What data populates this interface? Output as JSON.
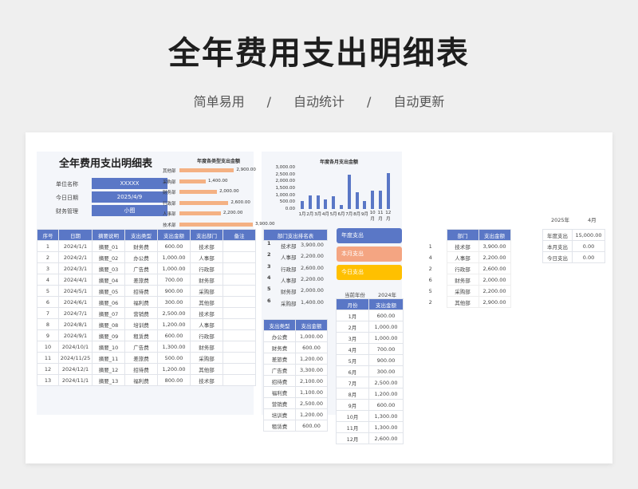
{
  "hero": {
    "title": "全年费用支出明细表",
    "subtitle": [
      "简单易用",
      "/",
      "自动统计",
      "/",
      "自动更新"
    ]
  },
  "doc": {
    "title": "全年费用支出明细表",
    "info": [
      {
        "label": "单位名称",
        "value": "XXXXX"
      },
      {
        "label": "今日日期",
        "value": "2025/4/9"
      },
      {
        "label": "财务管理",
        "value": "小图"
      }
    ]
  },
  "detail": {
    "headers": [
      "序号",
      "日期",
      "摘要说明",
      "支出类型",
      "支出金额",
      "支出部门",
      "备注"
    ],
    "rows": [
      [
        "1",
        "2024/1/1",
        "摘要_01",
        "财务费",
        "600.00",
        "技术部",
        ""
      ],
      [
        "2",
        "2024/2/1",
        "摘要_02",
        "办公费",
        "1,000.00",
        "人事部",
        ""
      ],
      [
        "3",
        "2024/3/1",
        "摘要_03",
        "广告费",
        "1,000.00",
        "行政部",
        ""
      ],
      [
        "4",
        "2024/4/1",
        "摘要_04",
        "差旅费",
        "700.00",
        "财务部",
        ""
      ],
      [
        "5",
        "2024/5/1",
        "摘要_05",
        "招待费",
        "900.00",
        "采购部",
        ""
      ],
      [
        "6",
        "2024/6/1",
        "摘要_06",
        "福利费",
        "300.00",
        "其他部",
        ""
      ],
      [
        "7",
        "2024/7/1",
        "摘要_07",
        "营销费",
        "2,500.00",
        "技术部",
        ""
      ],
      [
        "8",
        "2024/8/1",
        "摘要_08",
        "培训费",
        "1,200.00",
        "人事部",
        ""
      ],
      [
        "9",
        "2024/9/1",
        "摘要_09",
        "租赁费",
        "600.00",
        "行政部",
        ""
      ],
      [
        "10",
        "2024/10/1",
        "摘要_10",
        "广告费",
        "1,300.00",
        "财务部",
        ""
      ],
      [
        "11",
        "2024/11/25",
        "摘要_11",
        "差旅费",
        "500.00",
        "采购部",
        ""
      ],
      [
        "12",
        "2024/12/1",
        "摘要_12",
        "招待费",
        "1,200.00",
        "其他部",
        ""
      ],
      [
        "13",
        "2024/11/1",
        "摘要_13",
        "福利费",
        "800.00",
        "技术部",
        ""
      ]
    ]
  },
  "rank": {
    "headers": [
      "部门支出排名表"
    ],
    "rows": [
      [
        "1",
        "技术部",
        "3,900.00"
      ],
      [
        "2",
        "人事部",
        "2,200.00"
      ],
      [
        "3",
        "行政部",
        "2,600.00"
      ],
      [
        "4",
        "人事部",
        "2,200.00"
      ],
      [
        "5",
        "财务部",
        "2,000.00"
      ],
      [
        "6",
        "采购部",
        "1,400.00"
      ]
    ]
  },
  "types": {
    "headers": [
      "支出类型",
      "支出金额"
    ],
    "rows": [
      [
        "办公费",
        "1,000.00"
      ],
      [
        "财务费",
        "600.00"
      ],
      [
        "差旅费",
        "1,200.00"
      ],
      [
        "广告费",
        "3,300.00"
      ],
      [
        "招待费",
        "2,100.00"
      ],
      [
        "福利费",
        "1,100.00"
      ],
      [
        "营销费",
        "2,500.00"
      ],
      [
        "培训费",
        "1,200.00"
      ],
      [
        "租赁费",
        "600.00"
      ]
    ]
  },
  "kpi": [
    {
      "label": "年度支出",
      "color": "#5a77c6"
    },
    {
      "label": "本月支出",
      "color": "#f4a582"
    },
    {
      "label": "今日支出",
      "color": "#ffc000"
    }
  ],
  "monthly": {
    "current_year_label": "当前年份",
    "current_year": "2024年",
    "headers": [
      "月份",
      "支出金额"
    ],
    "rows": [
      [
        "1月",
        "600.00"
      ],
      [
        "2月",
        "1,000.00"
      ],
      [
        "3月",
        "1,000.00"
      ],
      [
        "4月",
        "700.00"
      ],
      [
        "5月",
        "900.00"
      ],
      [
        "6月",
        "300.00"
      ],
      [
        "7月",
        "2,500.00"
      ],
      [
        "8月",
        "1,200.00"
      ],
      [
        "9月",
        "600.00"
      ],
      [
        "10月",
        "1,300.00"
      ],
      [
        "11月",
        "1,300.00"
      ],
      [
        "12月",
        "2,600.00"
      ]
    ]
  },
  "dept_table": {
    "headers": [
      "部门",
      "支出金额"
    ],
    "rows": [
      [
        "1",
        "技术部",
        "3,900.00"
      ],
      [
        "4",
        "人事部",
        "2,200.00"
      ],
      [
        "2",
        "行政部",
        "2,600.00"
      ],
      [
        "6",
        "财务部",
        "2,000.00"
      ],
      [
        "5",
        "采购部",
        "2,200.00"
      ],
      [
        "2",
        "其他部",
        "2,900.00"
      ]
    ]
  },
  "summary": {
    "year_label": "2025年",
    "month_label": "4月",
    "rows": [
      [
        "年度支出",
        "15,000.00"
      ],
      [
        "本月支出",
        "0.00"
      ],
      [
        "今日支出",
        "0.00"
      ]
    ]
  },
  "chart_data": [
    {
      "type": "bar",
      "orientation": "horizontal",
      "title": "年度各类型支出金额",
      "categories": [
        "其他部",
        "采购部",
        "财务部",
        "行政部",
        "人事部",
        "技术部"
      ],
      "values": [
        2900,
        1400,
        2000,
        2600,
        2200,
        3900
      ],
      "labels": [
        "2,900.00",
        "1,400.00",
        "2,000.00",
        "2,600.00",
        "2,200.00",
        "3,900.00"
      ],
      "color": "#f4b183"
    },
    {
      "type": "bar",
      "title": "年度各月支出金额",
      "categories": [
        "1月",
        "2月",
        "3月",
        "4月",
        "5月",
        "6月",
        "7月",
        "8月",
        "9月",
        "10月",
        "11月",
        "12月"
      ],
      "values": [
        600,
        1000,
        1000,
        700,
        900,
        300,
        2500,
        1200,
        600,
        1300,
        1300,
        2600
      ],
      "yticks": [
        "3,000.00",
        "2,500.00",
        "2,000.00",
        "1,500.00",
        "1,000.00",
        "500.00",
        "0.00"
      ],
      "ylim": [
        0,
        3000
      ],
      "color": "#5a77c6"
    }
  ]
}
